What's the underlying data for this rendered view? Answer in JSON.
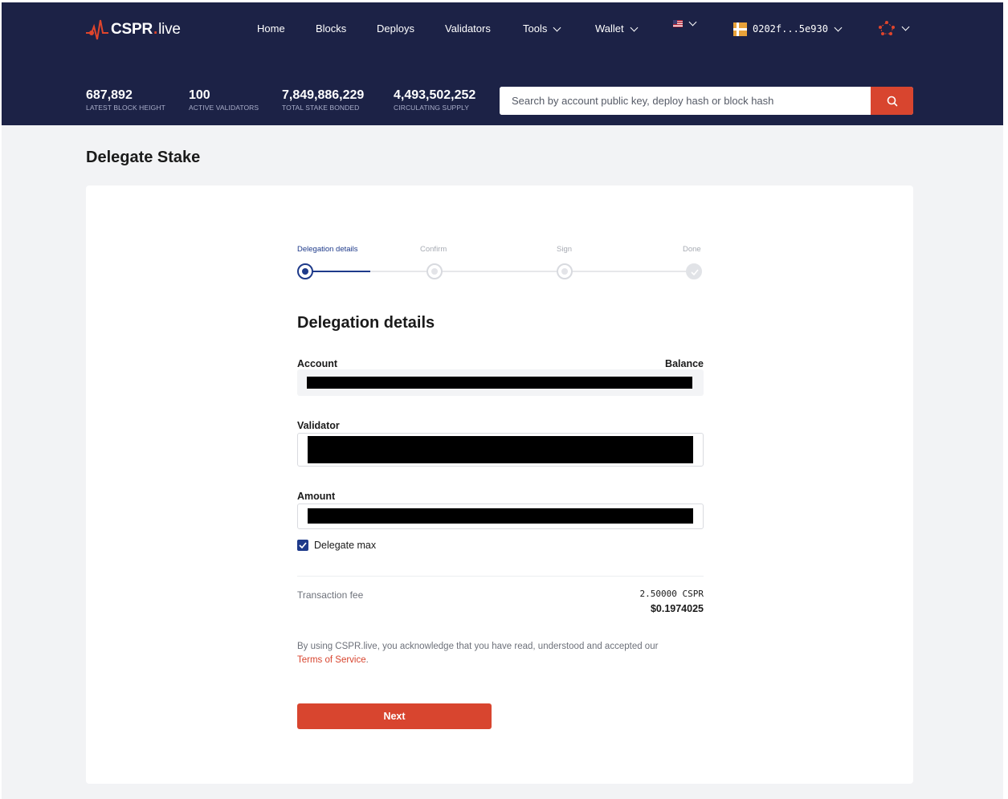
{
  "header": {
    "logo": {
      "brand": "CSPR",
      "separator": ".",
      "suffix": "live"
    },
    "nav": [
      {
        "label": "Home"
      },
      {
        "label": "Blocks"
      },
      {
        "label": "Deploys"
      },
      {
        "label": "Validators"
      },
      {
        "label": "Tools",
        "dropdown": true
      },
      {
        "label": "Wallet",
        "dropdown": true
      }
    ],
    "language_icon": "us-flag-icon",
    "account": {
      "label": "0202f...5e930",
      "icon": "account-avatar-icon"
    },
    "network_icon": "network-icon",
    "stats": [
      {
        "value": "687,892",
        "label": "Latest Block Height"
      },
      {
        "value": "100",
        "label": "Active Validators"
      },
      {
        "value": "7,849,886,229",
        "label": "Total Stake Bonded"
      },
      {
        "value": "4,493,502,252",
        "label": "Circulating Supply"
      }
    ],
    "search": {
      "placeholder": "Search by account public key, deploy hash or block hash",
      "icon": "search-icon"
    }
  },
  "page": {
    "title": "Delegate Stake"
  },
  "stepper": {
    "steps": [
      {
        "label": "Delegation details",
        "state": "active"
      },
      {
        "label": "Confirm",
        "state": "pending"
      },
      {
        "label": "Sign",
        "state": "pending"
      },
      {
        "label": "Done",
        "state": "pending"
      }
    ]
  },
  "form": {
    "title": "Delegation details",
    "account_label": "Account",
    "balance_label": "Balance",
    "validator_label": "Validator",
    "amount_label": "Amount",
    "delegate_max_label": "Delegate max",
    "delegate_max_checked": true,
    "fee": {
      "label": "Transaction fee",
      "cspr": "2.50000 CSPR",
      "usd": "$0.1974025"
    },
    "legal": {
      "text": "By using CSPR.live, you acknowledge that you have read, understood and accepted our",
      "link": "Terms of Service",
      "end": "."
    },
    "next_label": "Next"
  },
  "colors": {
    "header_bg": "#1c2246",
    "accent": "#d8452f",
    "primary": "#1e3a8a",
    "page_bg": "#f2f3f5"
  }
}
